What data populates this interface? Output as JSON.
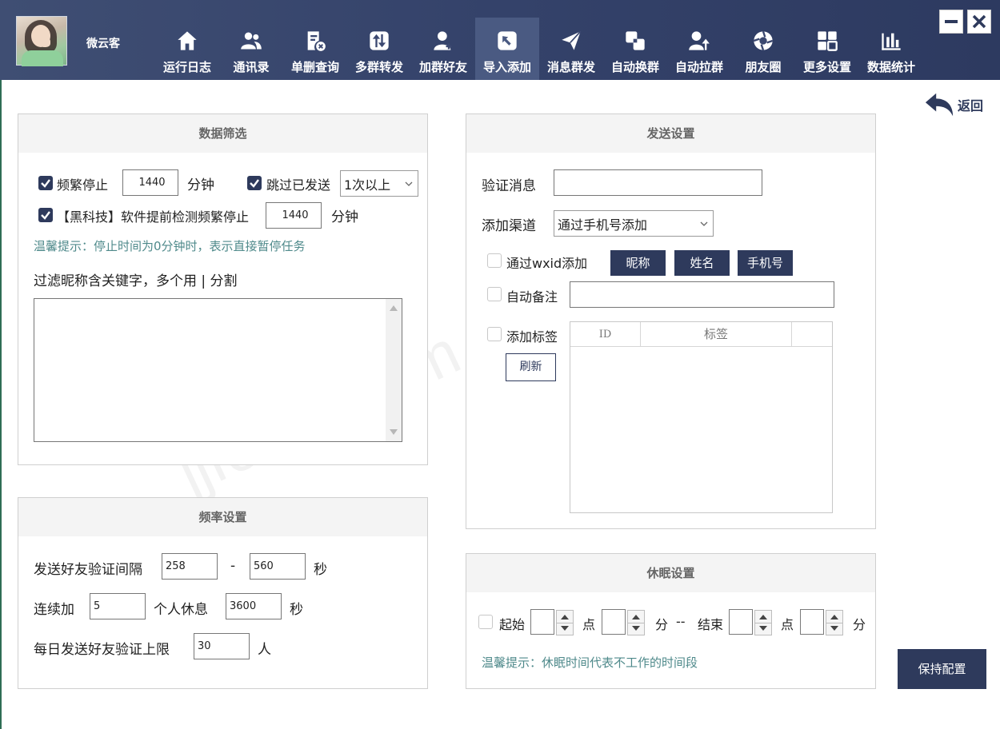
{
  "user": {
    "name": "微云客"
  },
  "nav": [
    {
      "label": "运行日志",
      "icon": "home-icon"
    },
    {
      "label": "通讯录",
      "icon": "contacts-icon"
    },
    {
      "label": "单删查询",
      "icon": "delete-check-icon"
    },
    {
      "label": "多群转发",
      "icon": "forward-icon"
    },
    {
      "label": "加群好友",
      "icon": "add-friend-icon"
    },
    {
      "label": "导入添加",
      "icon": "import-icon",
      "active": true
    },
    {
      "label": "消息群发",
      "icon": "send-icon"
    },
    {
      "label": "自动换群",
      "icon": "switch-group-icon"
    },
    {
      "label": "自动拉群",
      "icon": "pull-group-icon"
    },
    {
      "label": "朋友圈",
      "icon": "moments-icon"
    },
    {
      "label": "更多设置",
      "icon": "grid-icon"
    },
    {
      "label": "数据统计",
      "icon": "bar-chart-icon"
    }
  ],
  "back_label": "返回",
  "filter": {
    "title": "数据筛选",
    "freq_stop_label": "频繁停止",
    "freq_stop_value": "1440",
    "freq_stop_unit": "分钟",
    "skip_sent_label": "跳过已发送",
    "skip_sent_option": "1次以上",
    "blacktech_label": "【黑科技】软件提前检测频繁停止",
    "blacktech_value": "1440",
    "blacktech_unit": "分钟",
    "tip": "温馨提示：停止时间为0分钟时，表示直接暂停任务",
    "keyword_label": "过滤昵称含关键字，多个用 | 分割",
    "keyword_value": ""
  },
  "frequency": {
    "title": "频率设置",
    "interval_label": "发送好友验证间隔",
    "interval_min": "258",
    "interval_sep": "-",
    "interval_max": "560",
    "interval_unit": "秒",
    "continuous_label": "连续加",
    "continuous_value": "5",
    "rest_label": "个人休息",
    "rest_value": "3600",
    "rest_unit": "秒",
    "daily_label": "每日发送好友验证上限",
    "daily_value": "30",
    "daily_unit": "人"
  },
  "send": {
    "title": "发送设置",
    "verify_label": "验证消息",
    "verify_value": "",
    "channel_label": "添加渠道",
    "channel_value": "通过手机号添加",
    "wxid_label": "通过wxid添加",
    "btn_nickname": "昵称",
    "btn_name": "姓名",
    "btn_phone": "手机号",
    "remark_label": "自动备注",
    "remark_value": "",
    "tag_label": "添加标签",
    "refresh_label": "刷新",
    "table_headers": [
      "ID",
      "标签"
    ]
  },
  "sleep": {
    "title": "休眠设置",
    "start_label": "起始",
    "hour_unit": "点",
    "minute_unit": "分",
    "sep": "--",
    "end_label": "结束",
    "start_hour": "",
    "start_minute": "",
    "end_hour": "",
    "end_minute": "",
    "tip": "温馨提示：休眠时间代表不工作的时间段"
  },
  "save_label": "保持配置",
  "watermark": "jjfoma.com",
  "colors": {
    "header": "#34426a",
    "accent": "#2e3a5c",
    "tip": "#4f8a8b"
  }
}
